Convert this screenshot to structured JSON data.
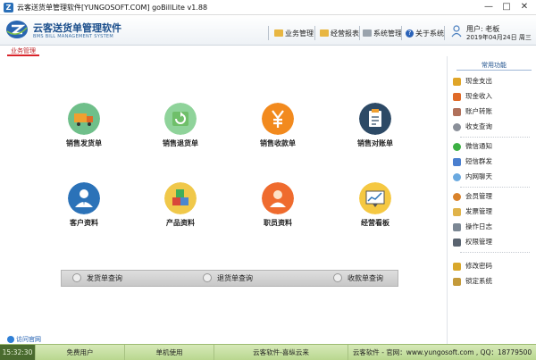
{
  "window": {
    "title": "云客送货单管理软件[YUNGOSOFT.COM]  goBillLite v1.88",
    "minimize": "—",
    "maximize": "□",
    "close": "✕"
  },
  "brand": {
    "name": "云客送货单管理软件",
    "subtitle": "BMS BILL MANAGEMENT SYSTEM"
  },
  "topnav": [
    {
      "label": "业务管理",
      "icon": "folder-icon"
    },
    {
      "label": "经营报表",
      "icon": "folder-icon"
    },
    {
      "label": "系统管理",
      "icon": "system-icon"
    },
    {
      "label": "关于系统",
      "icon": "help-icon"
    }
  ],
  "user": {
    "name_line": "用户: 老板",
    "date_line": "2019年04月24日 周三"
  },
  "active_tab": "业务管理",
  "tiles": [
    {
      "label": "销售发货单",
      "color": "#6fbf8a",
      "icon": "truck-icon"
    },
    {
      "label": "销售退货单",
      "color": "#8fd39a",
      "icon": "return-icon"
    },
    {
      "label": "销售收款单",
      "color": "#f28a1e",
      "icon": "yen-icon"
    },
    {
      "label": "销售对账单",
      "color": "#2d4a66",
      "icon": "clipboard-icon"
    },
    {
      "label": "客户资料",
      "color": "#2b72b8",
      "icon": "customer-icon"
    },
    {
      "label": "产品资料",
      "color": "#f0c84a",
      "icon": "product-icon"
    },
    {
      "label": "职员资料",
      "color": "#ef6b2e",
      "icon": "staff-icon"
    },
    {
      "label": "经营看板",
      "color": "#f5c842",
      "icon": "dashboard-icon"
    }
  ],
  "queries": [
    "发货单查询",
    "退货单查询",
    "收款单查询"
  ],
  "sidebar": {
    "title": "常用功能",
    "groups": [
      [
        {
          "label": "现金支出",
          "color": "#e0a528"
        },
        {
          "label": "现金收入",
          "color": "#e06a28"
        },
        {
          "label": "账户转账",
          "color": "#b0705a"
        },
        {
          "label": "收支查询",
          "color": "#8a8f99"
        }
      ],
      [
        {
          "label": "微信通知",
          "color": "#3cb043"
        },
        {
          "label": "短信群发",
          "color": "#4a7fcf"
        },
        {
          "label": "内网聊天",
          "color": "#6aa9e0"
        }
      ],
      [
        {
          "label": "会员管理",
          "color": "#d9822b"
        },
        {
          "label": "发票管理",
          "color": "#e0b34a"
        },
        {
          "label": "操作日志",
          "color": "#7b8794"
        },
        {
          "label": "权限管理",
          "color": "#5a6470"
        }
      ],
      [
        {
          "label": "修改密码",
          "color": "#d9a82b"
        },
        {
          "label": "锁定系统",
          "color": "#c49a3a"
        }
      ]
    ]
  },
  "visit_link": "访问官网",
  "status": {
    "time": "15:32:30",
    "user_type": "免费用户",
    "mode": "单机使用",
    "slogan": "云客软件-喜纵云来",
    "contact": "云客软件 - 官网：www.yungosoft.com , QQ：18779500"
  }
}
